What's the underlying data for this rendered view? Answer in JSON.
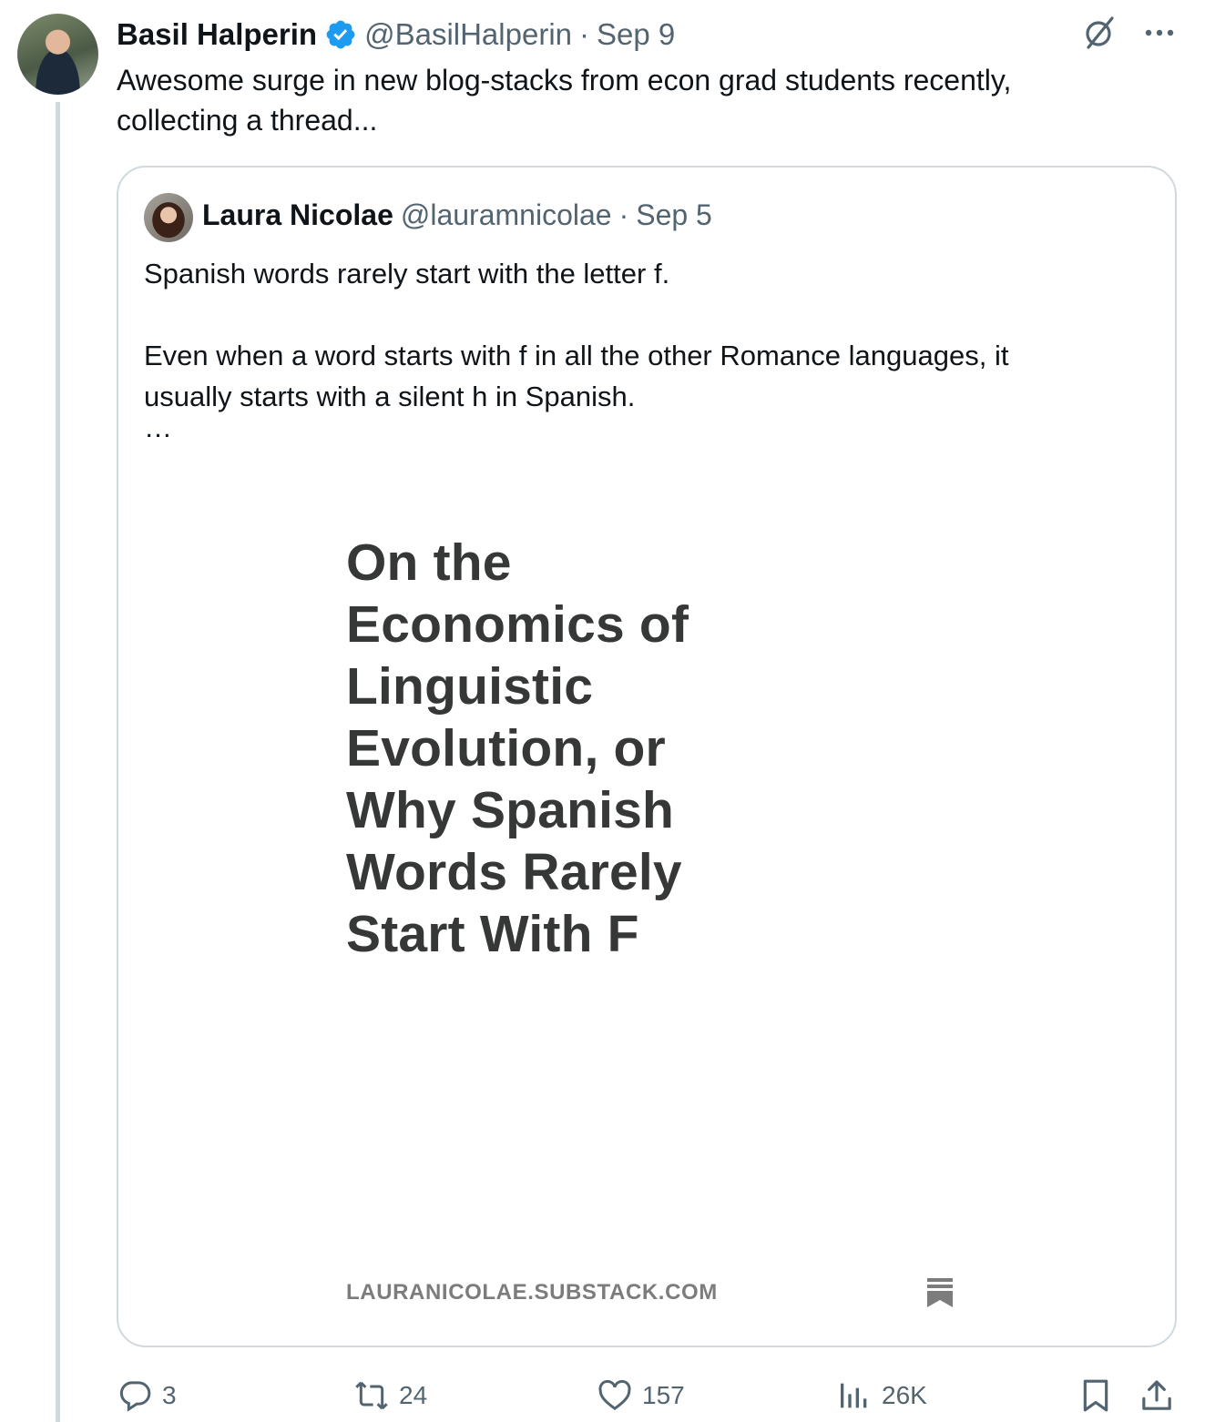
{
  "author": {
    "name": "Basil Halperin",
    "handle": "@BasilHalperin",
    "separator": "·",
    "date": "Sep 9",
    "verified": true
  },
  "tweet": {
    "text_line1": "Awesome surge in new blog-stacks from econ grad students recently,",
    "text_line2": "collecting a thread..."
  },
  "quoted": {
    "name": "Laura Nicolae",
    "handle": "@lauramnicolae",
    "separator": "·",
    "date": "Sep 5",
    "para1": "Spanish words rarely start with the letter f.",
    "para2_line1": "Even when a word starts with f in all the other Romance languages, it",
    "para2_line2": "usually starts with a silent h in Spanish.",
    "ellipsis": "…",
    "card": {
      "title_lines": [
        "On the",
        "Economics of",
        "Linguistic",
        "Evolution, or",
        "Why Spanish",
        "Words Rarely",
        "Start With F"
      ],
      "domain": "LAURANICOLAE.SUBSTACK.COM"
    }
  },
  "actions": {
    "replies": "3",
    "reposts": "24",
    "likes": "157",
    "views": "26K"
  },
  "icons": {
    "grok": "grok-icon",
    "more": "more-icon",
    "reply": "reply-icon",
    "repost": "repost-icon",
    "like": "heart-icon",
    "views": "views-icon",
    "bookmark": "bookmark-icon",
    "share": "share-icon"
  },
  "colors": {
    "verified_blue": "#1d9bf0",
    "secondary_text": "#536471",
    "border": "#cfd9de"
  }
}
